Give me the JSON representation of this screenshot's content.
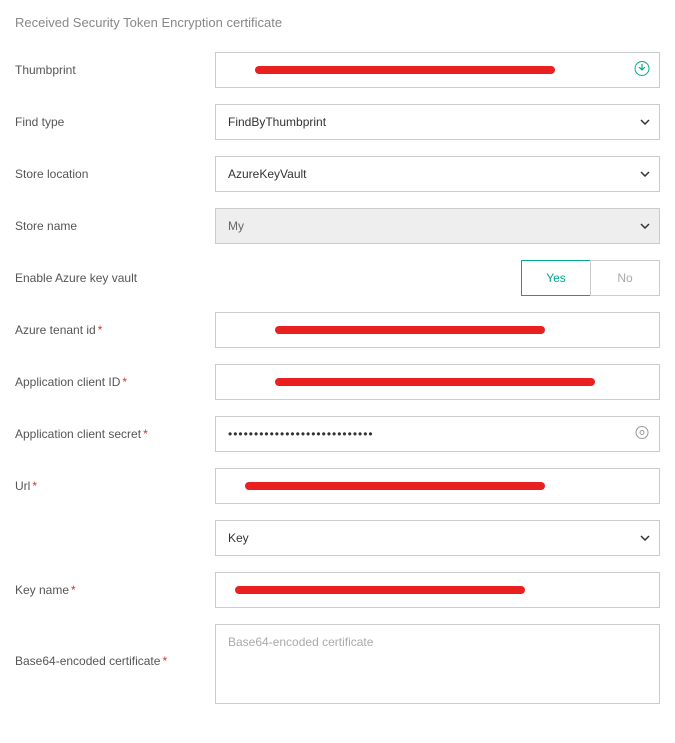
{
  "section_title": "Received Security Token Encryption certificate",
  "fields": {
    "thumbprint": {
      "label": "Thumbprint",
      "value": ""
    },
    "find_type": {
      "label": "Find type",
      "value": "FindByThumbprint"
    },
    "store_location": {
      "label": "Store location",
      "value": "AzureKeyVault"
    },
    "store_name": {
      "label": "Store name",
      "value": "My"
    },
    "enable_akv": {
      "label": "Enable Azure key vault",
      "yes": "Yes",
      "no": "No"
    },
    "tenant_id": {
      "label": "Azure tenant id",
      "value": ""
    },
    "client_id": {
      "label": "Application client ID",
      "value": ""
    },
    "client_secret": {
      "label": "Application client secret",
      "value": "••••••••••••••••••••••••••••"
    },
    "url": {
      "label": "Url",
      "value": ""
    },
    "key_type": {
      "value": "Key"
    },
    "key_name": {
      "label": "Key name",
      "value": ""
    },
    "b64cert": {
      "label": "Base64-encoded certificate",
      "placeholder": "Base64-encoded certificate",
      "value": ""
    }
  },
  "required_marker": "*",
  "colors": {
    "accent": "#00a88e",
    "redact": "#e92020"
  }
}
